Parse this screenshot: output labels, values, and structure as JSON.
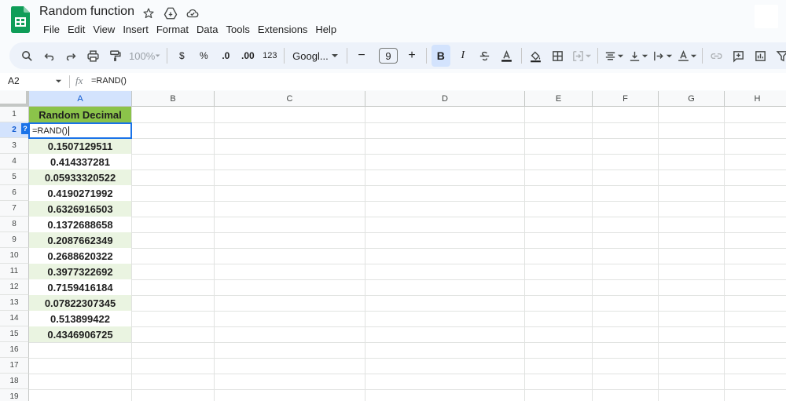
{
  "app": {
    "title": "Random function",
    "menus": [
      "File",
      "Edit",
      "View",
      "Insert",
      "Format",
      "Data",
      "Tools",
      "Extensions",
      "Help"
    ]
  },
  "toolbar": {
    "zoom": "100%",
    "currency": "$",
    "percent": "%",
    "dec_decrease": ".0",
    "dec_increase": ".00",
    "number_format": "123",
    "font": "Googl...",
    "font_size": "9",
    "minus": "−",
    "plus": "+",
    "bold": "B",
    "italic": "I"
  },
  "formula_bar": {
    "name_box": "A2",
    "fx": "fx",
    "formula": "=RAND()"
  },
  "grid": {
    "columns": [
      "A",
      "B",
      "C",
      "D",
      "E",
      "F",
      "G",
      "H"
    ],
    "rows": [
      "1",
      "2",
      "3",
      "4",
      "5",
      "6",
      "7",
      "8",
      "9",
      "10",
      "11",
      "12",
      "13",
      "14",
      "15",
      "16",
      "17",
      "18",
      "19"
    ],
    "header_cell": "Random Decimal",
    "active_cell_text": "=RAND()",
    "help_badge": "?",
    "values": [
      "0.1507129511",
      "0.414337281",
      "0.05933320522",
      "0.4190271992",
      "0.6326916503",
      "0.1372688658",
      "0.2087662349",
      "0.2688620322",
      "0.3977322692",
      "0.7159416184",
      "0.07822307345",
      "0.513899422",
      "0.4346906725"
    ]
  },
  "colors": {
    "header_green": "#8bc34a",
    "alt_row_green": "#eaf4e1",
    "selection_blue": "#1a73e8",
    "sheets_green": "#0f9d58"
  }
}
